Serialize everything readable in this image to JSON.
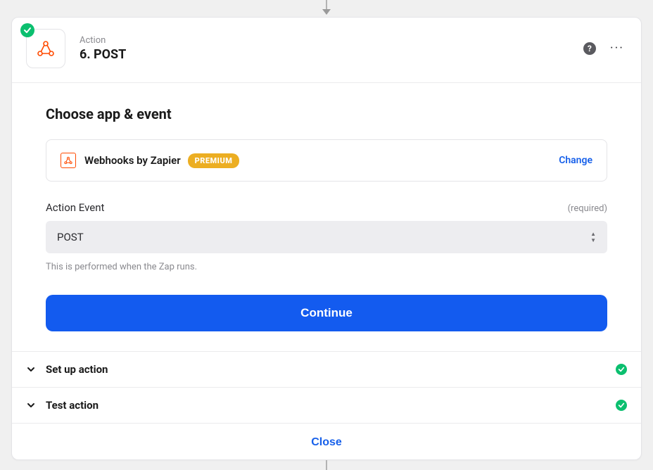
{
  "header": {
    "label": "Action",
    "title": "6. POST"
  },
  "icons": {
    "app": "webhooks-icon",
    "help": "?",
    "more": "···"
  },
  "section": {
    "title": "Choose app & event",
    "app_name": "Webhooks by Zapier",
    "premium": "PREMIUM",
    "change": "Change",
    "field_label": "Action Event",
    "required": "(required)",
    "select_value": "POST",
    "helper": "This is performed when the Zap runs.",
    "continue": "Continue"
  },
  "accordion": {
    "setup": "Set up action",
    "test": "Test action"
  },
  "footer": {
    "close": "Close"
  }
}
